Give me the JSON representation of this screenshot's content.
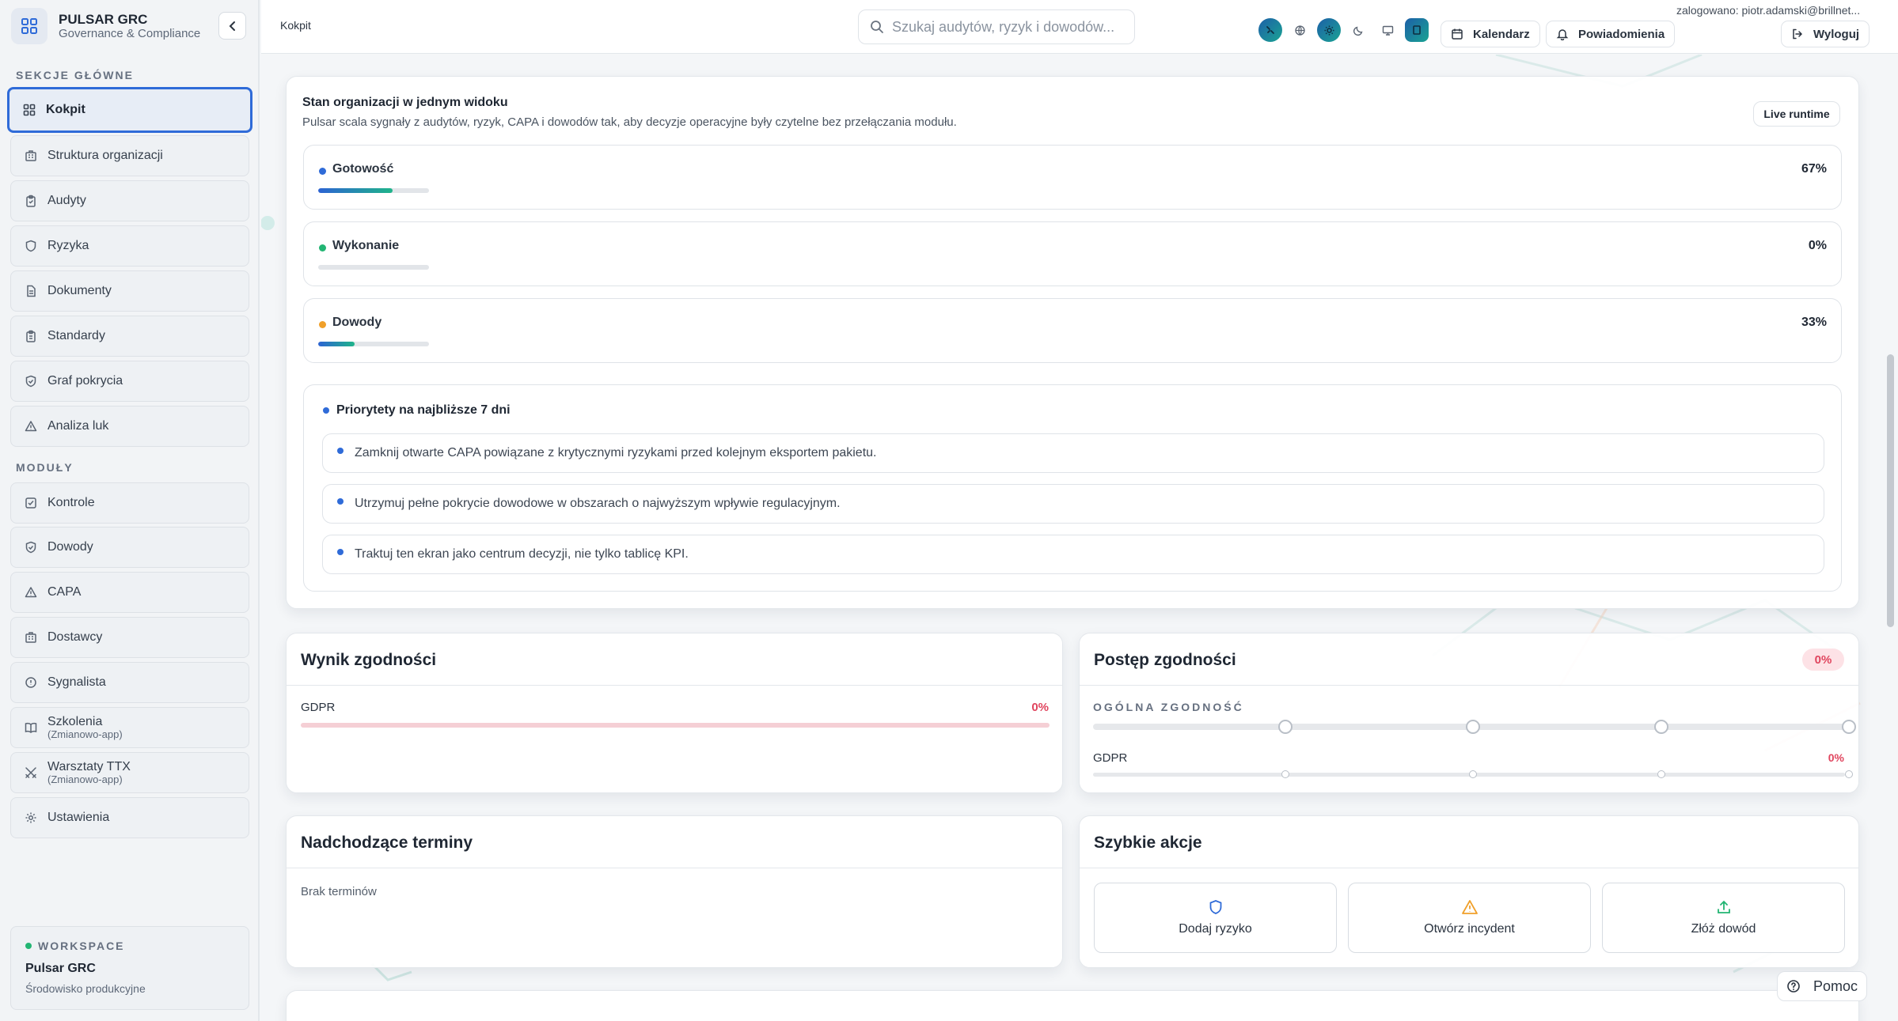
{
  "brand": {
    "name": "PULSAR GRC",
    "subtitle": "Governance & Compliance"
  },
  "sidebar": {
    "section_main": "SEKCJE GŁÓWNE",
    "section_modules": "MODUŁY",
    "main_items": [
      {
        "label": "Kokpit",
        "icon": "grid-icon",
        "active": true
      },
      {
        "label": "Struktura organizacji",
        "icon": "building-icon"
      },
      {
        "label": "Audyty",
        "icon": "clipboard-icon"
      },
      {
        "label": "Ryzyka",
        "icon": "shield-icon"
      },
      {
        "label": "Dokumenty",
        "icon": "document-icon"
      },
      {
        "label": "Standardy",
        "icon": "clipboard-icon"
      },
      {
        "label": "Graf pokrycia",
        "icon": "shield-check-icon"
      },
      {
        "label": "Analiza luk",
        "icon": "warning-icon"
      }
    ],
    "module_items": [
      {
        "label": "Kontrole",
        "icon": "checkbox-icon"
      },
      {
        "label": "Dowody",
        "icon": "shield-check-icon"
      },
      {
        "label": "CAPA",
        "icon": "warning-icon"
      },
      {
        "label": "Dostawcy",
        "icon": "building-icon"
      },
      {
        "label": "Sygnalista",
        "icon": "alert-circle-icon"
      },
      {
        "label": "Szkolenia",
        "sub": "(Zmianowo-app)",
        "icon": "book-icon"
      },
      {
        "label": "Warsztaty TTX",
        "sub": "(Zmianowo-app)",
        "icon": "swords-icon"
      },
      {
        "label": "Ustawienia",
        "icon": "gear-icon"
      }
    ],
    "workspace": {
      "label": "WORKSPACE",
      "name": "Pulsar GRC",
      "env": "Środowisko produkcyjne"
    }
  },
  "topbar": {
    "breadcrumb": "Kokpit",
    "search_placeholder": "Szukaj audytów, ryzyk i dowodów...",
    "calendar_label": "Kalendarz",
    "notifications_label": "Powiadomienia",
    "logout_label": "Wyloguj",
    "user": "zalogowano: piotr.adamski@brillnet..."
  },
  "overview": {
    "title": "Stan organizacji w jednym widoku",
    "subtitle": "Pulsar scala sygnały z audytów, ryzyk, CAPA i dowodów tak, aby decyzje operacyjne były czytelne bez przełączania modułu.",
    "badge": "Live runtime",
    "metrics": [
      {
        "label": "Gotowość",
        "value": "67%",
        "fraction": 0.67,
        "dot": "#2f6bd8"
      },
      {
        "label": "Wykonanie",
        "value": "0%",
        "fraction": 0.0,
        "dot": "#22b573"
      },
      {
        "label": "Dowody",
        "value": "33%",
        "fraction": 0.33,
        "dot": "#f0a02a"
      }
    ],
    "priorities_title": "Priorytety na najbliższe 7 dni",
    "priorities": [
      "Zamknij otwarte CAPA powiązane z krytycznymi ryzykami przed kolejnym eksportem pakietu.",
      "Utrzymuj pełne pokrycie dowodowe w obszarach o najwyższym wpływie regulacyjnym.",
      "Traktuj ten ekran jako centrum decyzji, nie tylko tablicę KPI."
    ]
  },
  "wynik": {
    "title": "Wynik zgodności",
    "row_label": "GDPR",
    "row_value": "0%"
  },
  "postep": {
    "title": "Postęp zgodności",
    "badge": "0%",
    "overall_label": "OGÓLNA ZGODNOŚĆ",
    "row_label": "GDPR",
    "row_value": "0%"
  },
  "terminy": {
    "title": "Nadchodzące terminy",
    "empty": "Brak terminów"
  },
  "akcje": {
    "title": "Szybkie akcje",
    "items": [
      {
        "label": "Dodaj ryzyko",
        "icon": "shield-icon"
      },
      {
        "label": "Otwórz incydent",
        "icon": "warning-icon"
      },
      {
        "label": "Złóż dowód",
        "icon": "upload-icon"
      }
    ]
  },
  "help": {
    "label": "Pomoc"
  },
  "colors": {
    "accent": "#2f6bd8",
    "teal": "#1aa393",
    "danger": "#e0455e",
    "warning": "#f0a02a",
    "success": "#22b573"
  }
}
